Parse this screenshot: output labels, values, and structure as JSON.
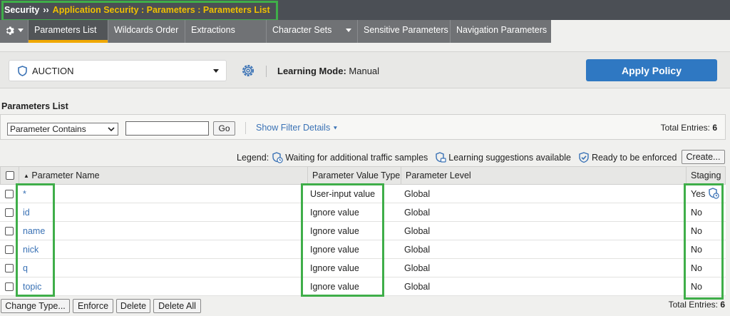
{
  "breadcrumb": {
    "root": "Security",
    "separator": "››",
    "path": "Application Security : Parameters : Parameters List"
  },
  "tabs": [
    {
      "label": "Parameters List",
      "active": true
    },
    {
      "label": "Wildcards Order"
    },
    {
      "label": "Extractions"
    },
    {
      "label": "Character Sets",
      "has_dropdown": true
    },
    {
      "label": "Sensitive Parameters"
    },
    {
      "label": "Navigation Parameters"
    }
  ],
  "policy": {
    "selected": "AUCTION",
    "learning_label": "Learning Mode:",
    "learning_value": "Manual",
    "apply_label": "Apply Policy"
  },
  "list": {
    "title": "Parameters List",
    "filter_option": "Parameter Contains",
    "filter_value": "",
    "go_label": "Go",
    "show_filter_label": "Show Filter Details",
    "total_label": "Total Entries:",
    "total_value": "6"
  },
  "legend": {
    "label": "Legend:",
    "waiting": "Waiting for additional traffic samples",
    "learning": "Learning suggestions available",
    "ready": "Ready to be enforced"
  },
  "create_label": "Create...",
  "table": {
    "headers": {
      "name": "Parameter Name",
      "value_type": "Parameter Value Type",
      "level": "Parameter Level",
      "staging": "Staging"
    },
    "rows": [
      {
        "name": "*",
        "value_type": "User-input value",
        "level": "Global",
        "staging": "Yes"
      },
      {
        "name": "id",
        "value_type": "Ignore value",
        "level": "Global",
        "staging": "No"
      },
      {
        "name": "name",
        "value_type": "Ignore value",
        "level": "Global",
        "staging": "No"
      },
      {
        "name": "nick",
        "value_type": "Ignore value",
        "level": "Global",
        "staging": "No"
      },
      {
        "name": "q",
        "value_type": "Ignore value",
        "level": "Global",
        "staging": "No"
      },
      {
        "name": "topic",
        "value_type": "Ignore value",
        "level": "Global",
        "staging": "No"
      }
    ]
  },
  "bottom": {
    "change_type": "Change Type...",
    "enforce": "Enforce",
    "delete": "Delete",
    "delete_all": "Delete All",
    "total_label": "Total Entries:",
    "total_value": "6"
  },
  "colors": {
    "accent": "#f0a800",
    "link": "#3a72b5",
    "apply": "#2f78c2",
    "highlight": "#3fae49"
  }
}
